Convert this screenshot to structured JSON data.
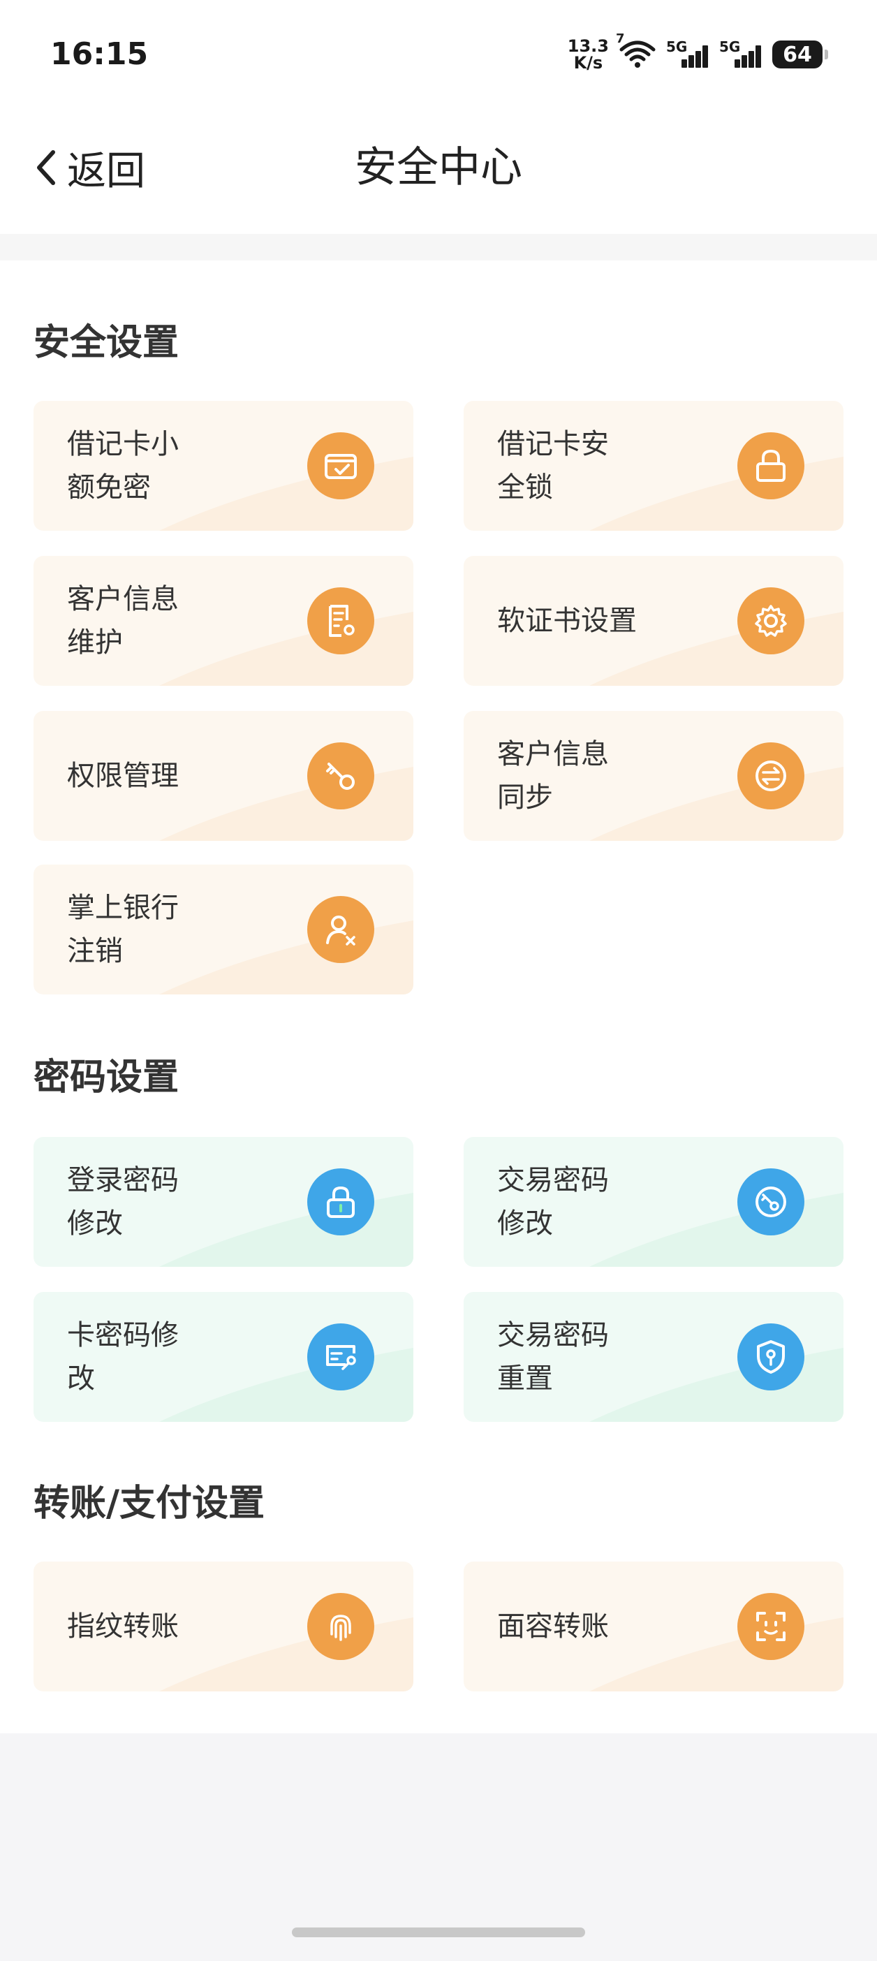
{
  "status_bar": {
    "time": "16:15",
    "net_speed_value": "13.3",
    "net_speed_unit": "K/s",
    "wifi_badge": "7",
    "sim1_label": "5G",
    "sim2_label": "5G",
    "battery": "64"
  },
  "nav": {
    "back_label": "返回",
    "title": "安全中心"
  },
  "sections": {
    "security": {
      "title": "安全设置",
      "items": [
        {
          "label": "借记卡小\n额免密",
          "icon": "card-check-icon"
        },
        {
          "label": "借记卡安\n全锁",
          "icon": "lock-icon"
        },
        {
          "label": "客户信息\n维护",
          "icon": "document-gear-icon"
        },
        {
          "label": "软证书设置",
          "icon": "gear-icon"
        },
        {
          "label": "权限管理",
          "icon": "key-icon"
        },
        {
          "label": "客户信息\n同步",
          "icon": "sync-icon"
        },
        {
          "label": "掌上银行\n注销",
          "icon": "user-remove-icon"
        }
      ]
    },
    "password": {
      "title": "密码设置",
      "items": [
        {
          "label": "登录密码\n修改",
          "icon": "padlock-icon"
        },
        {
          "label": "交易密码\n修改",
          "icon": "key-circle-icon"
        },
        {
          "label": "卡密码修\n改",
          "icon": "card-key-icon"
        },
        {
          "label": "交易密码\n重置",
          "icon": "shield-key-icon"
        }
      ]
    },
    "transfer": {
      "title": "转账/支付设置",
      "items": [
        {
          "label": "指纹转账",
          "icon": "fingerprint-icon"
        },
        {
          "label": "面容转账",
          "icon": "face-id-icon"
        }
      ]
    }
  },
  "colors": {
    "orange_icon": "#f0a048",
    "blue_icon": "#3fa6e8",
    "orange_card": "#fdf7ef",
    "green_card": "#effaf5"
  }
}
